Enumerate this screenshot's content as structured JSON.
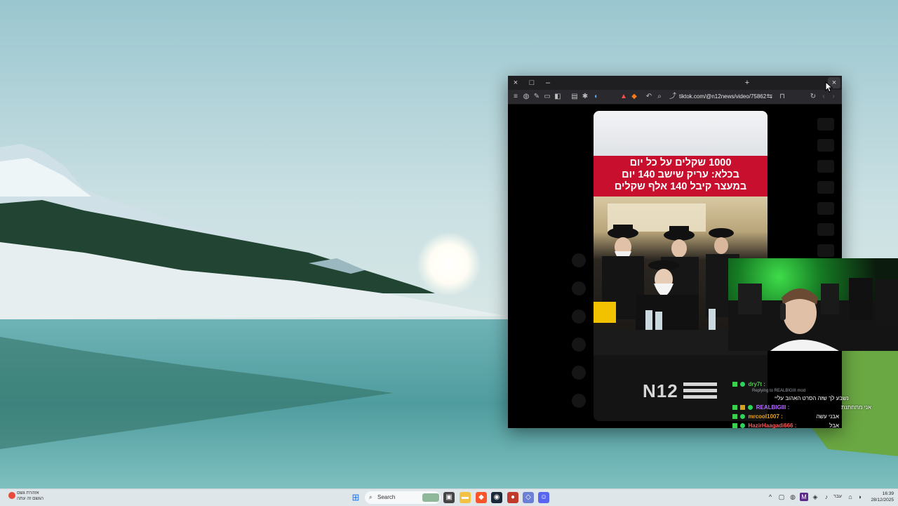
{
  "browser": {
    "new_tab_symbol": "+",
    "close_symbol": "×",
    "maximize_symbol": "□",
    "minimize_symbol": "–",
    "url": "tiktok.com/@n12news/video/75862..."
  },
  "video": {
    "headline_lines": [
      "1000 שקלים על כל יום",
      "בכלא: עריק שישב 140 יום",
      "במעצר קיבל 140 אלף שקלים"
    ],
    "watermark": "N12"
  },
  "chat": {
    "messages": [
      {
        "user": "dry7t :",
        "text": "",
        "color": "#53c153"
      },
      {
        "reply_note": "Replying to REALBIGIII mod",
        "text": "נשבע לך שזה הסרט האהוב עליי"
      },
      {
        "user": "REALBIGIII :",
        "text": "אני מתחתנת",
        "color": "#b46cff"
      },
      {
        "user": "mrcool1007 :",
        "text": "אבני עשה",
        "color": "#e8a21a"
      },
      {
        "user": "HazirHaagadi666 :",
        "text": "אבל",
        "color": "#ff5a5a"
      }
    ]
  },
  "taskbar": {
    "search_placeholder": "Search",
    "weather_line1": "אזהרת גשם",
    "weather_line2": "הגשם זה עתה",
    "lang": "עבר",
    "time": "16:39",
    "date": "28/12/2025"
  },
  "colors": {
    "headline_red": "#c8102e",
    "taskbar": "#dfe6ea",
    "browser_chrome": "#1f1f22"
  }
}
